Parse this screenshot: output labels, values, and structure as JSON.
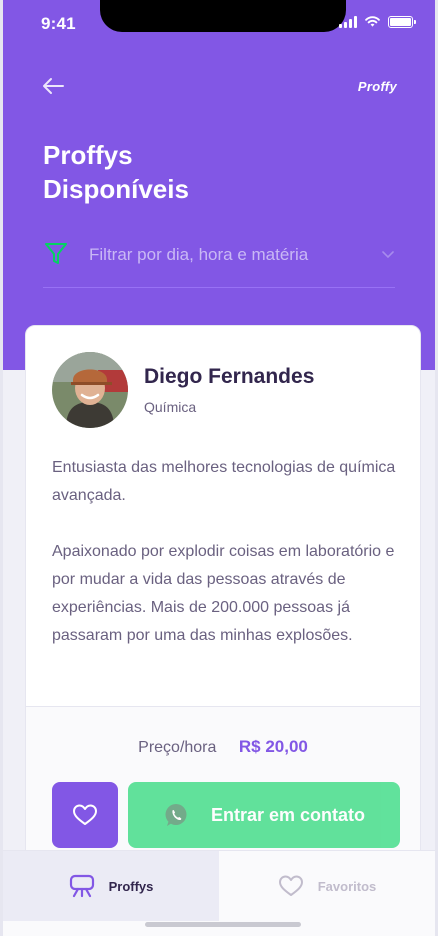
{
  "status_bar": {
    "time": "9:41"
  },
  "header": {
    "brand": "Proffy",
    "title": "Proffys Disponíveis",
    "back_icon": "arrow-left-icon"
  },
  "filter": {
    "placeholder": "Filtrar por dia, hora e matéria",
    "icon": "filter-icon"
  },
  "teacher": {
    "name": "Diego Fernandes",
    "subject": "Química",
    "bio": [
      "Entusiasta das melhores tecnologias de química avançada.",
      "Apaixonado por explodir coisas em laboratório e por mudar a vida das pessoas através de experiências. Mais de 200.000 pessoas já passaram por uma das minhas explosões."
    ],
    "price_label": "Preço/hora",
    "price_value": "R$ 20,00"
  },
  "actions": {
    "contact_label": "Entrar em contato",
    "favorite_icon": "heart-icon",
    "contact_icon": "whatsapp-icon"
  },
  "tabs": [
    {
      "label": "Proffys",
      "active": true,
      "icon": "teachers-icon"
    },
    {
      "label": "Favoritos",
      "active": false,
      "icon": "heart-icon"
    }
  ],
  "colors": {
    "primary": "#8257e5",
    "secondary": "#04d361",
    "title": "#32264d",
    "text": "#6a6180",
    "background": "#f0f0f7"
  }
}
